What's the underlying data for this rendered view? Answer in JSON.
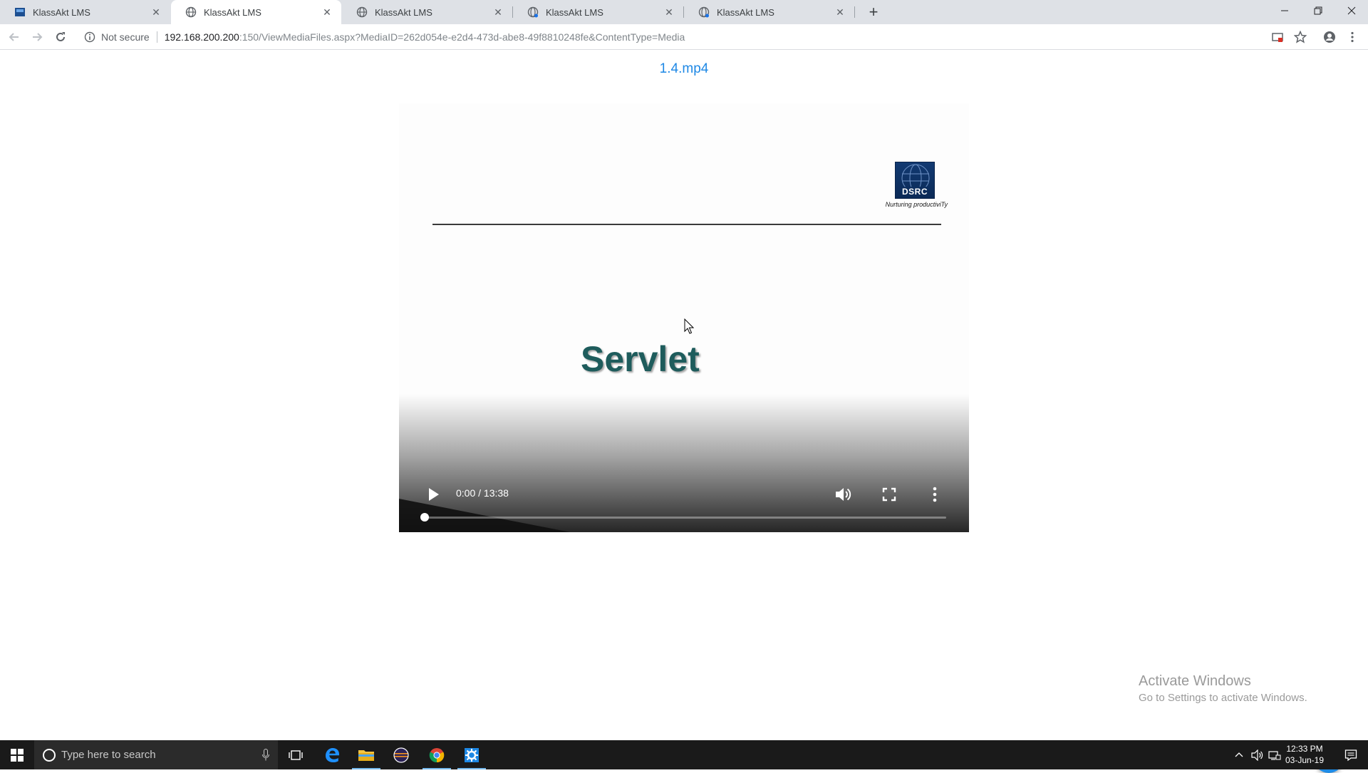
{
  "browser": {
    "tabs": [
      {
        "title": "KlassAkt LMS",
        "active": false,
        "icon": "klassakt-logo-icon"
      },
      {
        "title": "KlassAkt LMS",
        "active": true,
        "icon": "globe-icon"
      },
      {
        "title": "KlassAkt LMS",
        "active": false,
        "icon": "globe-icon"
      },
      {
        "title": "KlassAkt LMS",
        "active": false,
        "icon": "globe-loading-icon"
      },
      {
        "title": "KlassAkt LMS",
        "active": false,
        "icon": "globe-loading-icon"
      }
    ],
    "address": {
      "security_label": "Not secure",
      "host": "192.168.200.200",
      "path": ":150/ViewMediaFiles.aspx?MediaID=262d054e-e2d4-473d-abe8-49f8810248fe&ContentType=Media"
    }
  },
  "page": {
    "media_title": "1.4.mp4",
    "video": {
      "slide_heading": "Servlet",
      "logo_text": "DSRC",
      "logo_tagline": "Nurturing productiviTy",
      "time_display": "0:00 / 13:38",
      "progress_fraction": 0.0
    },
    "watermark": {
      "title": "Activate Windows",
      "subtitle": "Go to Settings to activate Windows."
    }
  },
  "taskbar": {
    "search_placeholder": "Type here to search",
    "clock_time": "12:33 PM",
    "clock_date": "03-Jun-19"
  },
  "colors": {
    "link_blue": "#1e88e5",
    "fab_blue": "#1e8be6",
    "slide_heading": "#1e5c5c",
    "tabstrip": "#dee1e6",
    "taskbar": "#1a1a1a"
  }
}
